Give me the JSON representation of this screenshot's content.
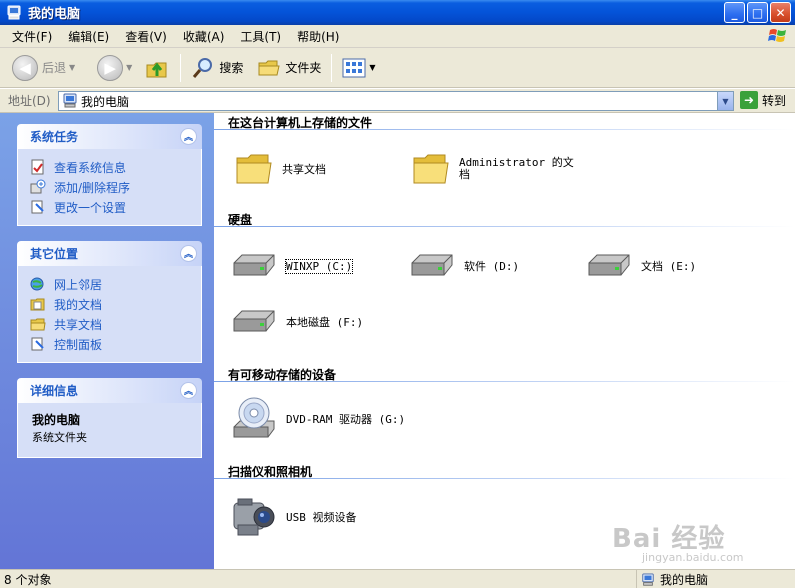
{
  "window": {
    "title": "我的电脑",
    "minimize": "_",
    "maximize": "□",
    "close": "✕"
  },
  "menu": [
    "文件(F)",
    "编辑(E)",
    "查看(V)",
    "收藏(A)",
    "工具(T)",
    "帮助(H)"
  ],
  "toolbar": {
    "back": "后退",
    "forward": "",
    "search": "搜索",
    "folders": "文件夹"
  },
  "address": {
    "label": "地址(D)",
    "value": "我的电脑",
    "go": "转到"
  },
  "sidebar": {
    "system_tasks": {
      "title": "系统任务",
      "items": [
        "查看系统信息",
        "添加/删除程序",
        "更改一个设置"
      ]
    },
    "other_places": {
      "title": "其它位置",
      "items": [
        "网上邻居",
        "我的文档",
        "共享文档",
        "控制面板"
      ]
    },
    "details": {
      "title": "详细信息",
      "name": "我的电脑",
      "type": "系统文件夹"
    }
  },
  "groups": {
    "files": {
      "title": "在这台计算机上存储的文件",
      "items": [
        "共享文档",
        "Administrator 的文档"
      ]
    },
    "hdd": {
      "title": "硬盘",
      "items": [
        "WINXP (C:)",
        "软件 (D:)",
        "文档 (E:)",
        "本地磁盘 (F:)"
      ]
    },
    "removable": {
      "title": "有可移动存储的设备",
      "items": [
        "DVD-RAM 驱动器 (G:)"
      ]
    },
    "scanners": {
      "title": "扫描仪和照相机",
      "items": [
        "USB 视频设备"
      ]
    }
  },
  "status": {
    "count": "8 个对象",
    "location": "我的电脑"
  },
  "watermark": {
    "brand": "Bai 经验",
    "url": "jingyan.baidu.com"
  }
}
